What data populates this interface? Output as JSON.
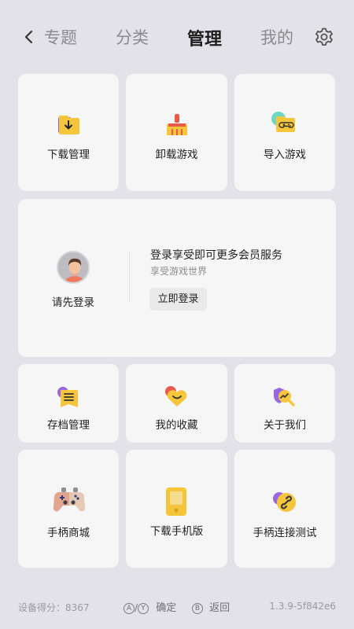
{
  "header": {
    "tabs": [
      "专题",
      "分类",
      "管理",
      "我的"
    ],
    "active_tab": "管理"
  },
  "tools": {
    "download_manage": "下载管理",
    "uninstall_game": "卸载游戏",
    "import_game": "导入游戏"
  },
  "login": {
    "prompt_label": "请先登录",
    "title": "登录享受即可更多会员服务",
    "subtitle": "享受游戏世界",
    "button_label": "立即登录"
  },
  "features": {
    "save_manage": "存档管理",
    "favorites": "我的收藏",
    "about_us": "关于我们",
    "gamepad_store": "手柄商城",
    "download_mobile": "下载手机版",
    "gamepad_test": "手柄连接测试"
  },
  "footer": {
    "device_score": "设备得分：8367",
    "key_a": "A",
    "key_y": "Y",
    "confirm_label": "确定",
    "key_b": "B",
    "back_label": "返回",
    "version": "1.3.9-5f842e6"
  },
  "colors": {
    "background": "#e2e2e8",
    "card": "#f6f6f6",
    "icon_yellow": "#f5c53c",
    "icon_purple": "#9a67e3",
    "icon_red": "#ea5a4a"
  }
}
